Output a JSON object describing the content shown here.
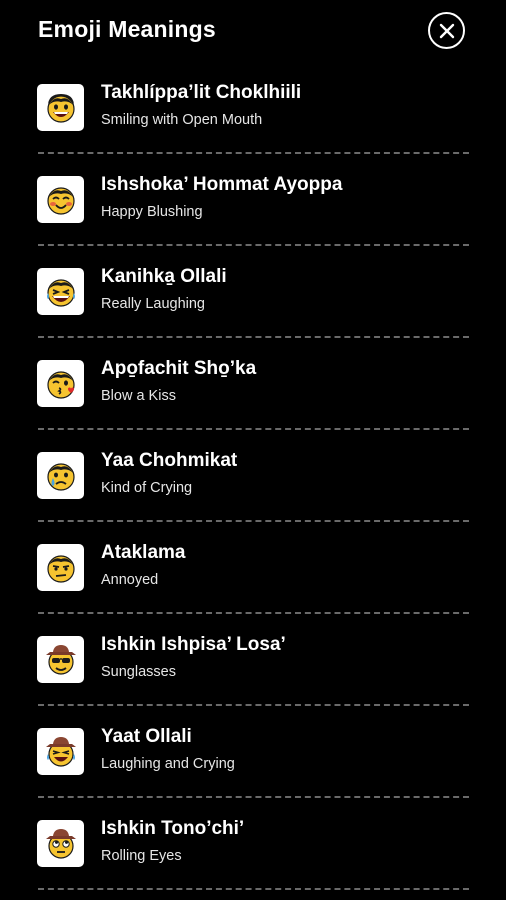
{
  "header": {
    "title": "Emoji Meanings",
    "close_icon": "close-circle-icon"
  },
  "colors": {
    "background": "#000000",
    "text": "#ffffff",
    "divider": "#6a6a6a",
    "tile": "#ffffff",
    "emoji_face": "#f6c430"
  },
  "items": [
    {
      "name": "Takhlíppa’lit Choklhiili",
      "meaning": "Smiling with Open Mouth",
      "icon": "smiling-open-mouth-icon"
    },
    {
      "name": "Ishshoka’ Hommat Ayoppa",
      "meaning": "Happy Blushing",
      "icon": "happy-blushing-icon"
    },
    {
      "name": "Kanihka̱ Ollali",
      "meaning": "Really Laughing",
      "icon": "really-laughing-icon"
    },
    {
      "name": "Apo̱fachit Sho̱’ka",
      "meaning": "Blow a Kiss",
      "icon": "blow-kiss-icon"
    },
    {
      "name": "Yaa Chohmikat",
      "meaning": "Kind of Crying",
      "icon": "kind-of-crying-icon"
    },
    {
      "name": "Ataklama",
      "meaning": "Annoyed",
      "icon": "annoyed-icon"
    },
    {
      "name": "Ishkin Ishpisa’ Losa’",
      "meaning": "Sunglasses",
      "icon": "sunglasses-icon"
    },
    {
      "name": "Yaat Ollali",
      "meaning": "Laughing and Crying",
      "icon": "laughing-crying-icon"
    },
    {
      "name": "Ishkin Tono’chi’",
      "meaning": "Rolling Eyes",
      "icon": "rolling-eyes-icon"
    }
  ]
}
